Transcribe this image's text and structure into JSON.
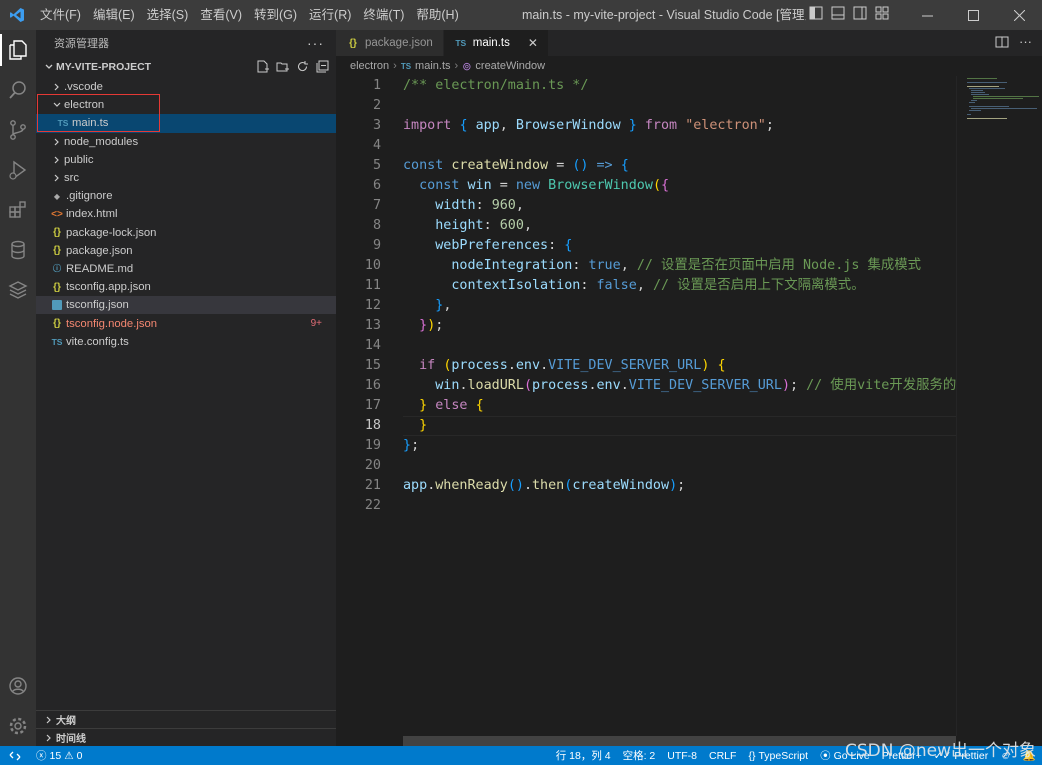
{
  "titlebar": {
    "menu": [
      "文件(F)",
      "编辑(E)",
      "选择(S)",
      "查看(V)",
      "转到(G)",
      "运行(R)",
      "终端(T)",
      "帮助(H)"
    ],
    "window_title": "main.ts - my-vite-project - Visual Studio Code [管理员]",
    "controls": {
      "minimize": "—",
      "maximize": "☐",
      "close": "✕"
    }
  },
  "sidebar": {
    "title": "资源管理器",
    "more": "···",
    "project": "MY-VITE-PROJECT",
    "tree": [
      {
        "name": ".vscode",
        "type": "folder",
        "collapsed": true
      },
      {
        "name": "electron",
        "type": "folder",
        "collapsed": false
      },
      {
        "name": "main.ts",
        "type": "ts",
        "indent": true,
        "selected": true,
        "icon": "TS"
      },
      {
        "name": "node_modules",
        "type": "folder",
        "collapsed": true
      },
      {
        "name": "public",
        "type": "folder",
        "collapsed": true
      },
      {
        "name": "src",
        "type": "folder",
        "collapsed": true
      },
      {
        "name": ".gitignore",
        "type": "git",
        "icon": "◆"
      },
      {
        "name": "index.html",
        "type": "html",
        "icon": "<>"
      },
      {
        "name": "package-lock.json",
        "type": "json",
        "icon": "{}"
      },
      {
        "name": "package.json",
        "type": "json",
        "icon": "{}"
      },
      {
        "name": "README.md",
        "type": "info",
        "icon": "ⓘ"
      },
      {
        "name": "tsconfig.app.json",
        "type": "json",
        "icon": "{}"
      },
      {
        "name": "tsconfig.json",
        "type": "tsconf",
        "hover": true
      },
      {
        "name": "tsconfig.node.json",
        "type": "json",
        "icon": "{}",
        "error": true,
        "badge": "9+"
      },
      {
        "name": "vite.config.ts",
        "type": "ts",
        "icon": "TS"
      }
    ],
    "outline": "大纲",
    "timeline": "时间线"
  },
  "tabs": [
    {
      "label": "package.json",
      "icon": "{}",
      "active": false
    },
    {
      "label": "main.ts",
      "icon": "TS",
      "active": true,
      "close": "✕"
    }
  ],
  "breadcrumbs": {
    "folder": "electron",
    "file_icon": "TS",
    "file": "main.ts",
    "symbol": "createWindow"
  },
  "code": {
    "line_numbers": [
      "1",
      "2",
      "3",
      "4",
      "5",
      "6",
      "7",
      "8",
      "9",
      "10",
      "11",
      "12",
      "13",
      "14",
      "15",
      "16",
      "17",
      "18",
      "19",
      "20",
      "21",
      "22"
    ],
    "current_line": 18
  },
  "statusbar": {
    "errors": "15",
    "warnings": "0",
    "position": "行 18，列 4",
    "spaces": "空格: 2",
    "encoding": "UTF-8",
    "eol": "CRLF",
    "language": "TypeScript",
    "golive": "Go Live",
    "prettier_plus": "Prettier+",
    "prettier": "Prettier"
  },
  "watermark": "CSDN @new出一个对象",
  "colors": {
    "accent": "#007acc",
    "selection": "#094771",
    "highlight_box": "#e53935"
  }
}
